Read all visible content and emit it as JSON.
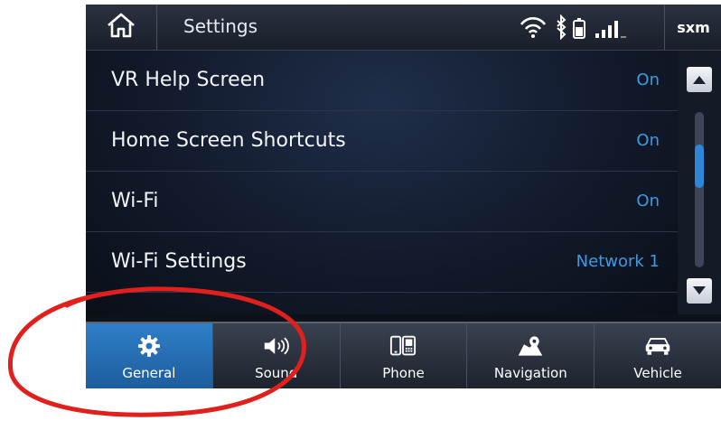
{
  "header": {
    "title": "Settings",
    "sxm_label": "sxm",
    "icons": [
      "home-icon",
      "wifi-icon",
      "bluetooth-icon",
      "battery-icon",
      "signal-icon"
    ]
  },
  "settings_list": [
    {
      "label": "VR Help Screen",
      "value": "On"
    },
    {
      "label": "Home Screen Shortcuts",
      "value": "On"
    },
    {
      "label": "Wi-Fi",
      "value": "On"
    },
    {
      "label": "Wi-Fi Settings",
      "value": "Network 1"
    }
  ],
  "tabs": [
    {
      "label": "General",
      "icon": "gear-icon",
      "active": true
    },
    {
      "label": "Sound",
      "icon": "speaker-icon",
      "active": false
    },
    {
      "label": "Phone",
      "icon": "phone-icon",
      "active": false
    },
    {
      "label": "Navigation",
      "icon": "map-pin-icon",
      "active": false
    },
    {
      "label": "Vehicle",
      "icon": "car-icon",
      "active": false
    }
  ],
  "colors": {
    "accent": "#3e9be0",
    "active_tab": "#2f7fc8",
    "annotation": "#e0201c"
  }
}
